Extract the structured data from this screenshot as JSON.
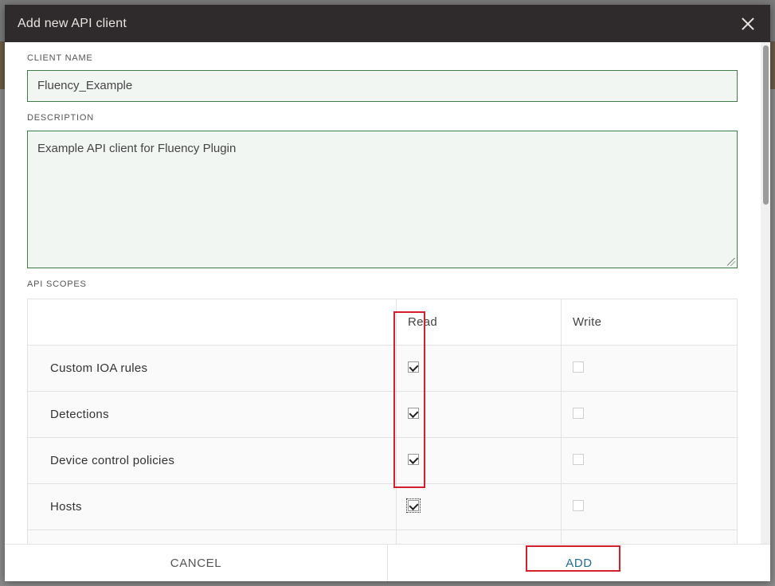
{
  "dialog": {
    "title": "Add new API client"
  },
  "form": {
    "client_name_label": "CLIENT NAME",
    "client_name_value": "Fluency_Example",
    "description_label": "DESCRIPTION",
    "description_value": "Example API client for Fluency Plugin",
    "scopes_label": "API SCOPES"
  },
  "scopes_table": {
    "columns": [
      "",
      "Read",
      "Write"
    ],
    "rows": [
      {
        "name": "Custom IOA rules",
        "read": true,
        "write": false
      },
      {
        "name": "Detections",
        "read": true,
        "write": false
      },
      {
        "name": "Device control policies",
        "read": true,
        "write": false
      },
      {
        "name": "Hosts",
        "read": true,
        "write": false
      }
    ]
  },
  "footer": {
    "cancel_label": "CANCEL",
    "add_label": "ADD"
  },
  "colors": {
    "header_bg": "#2f2b2c",
    "input_border": "#3e7d47",
    "input_bg": "#f2f6f3",
    "highlight": "#d4202d",
    "add_text": "#1f6e8c"
  }
}
